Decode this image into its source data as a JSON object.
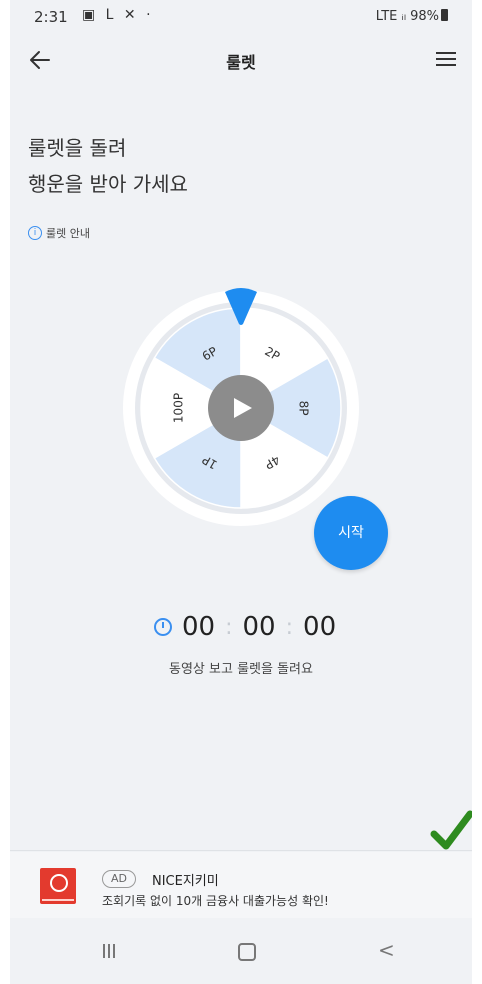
{
  "status_bar": {
    "time": "2:31",
    "icons": "▣ L ✕ ·",
    "right": "LTE ᵢₗ 98%"
  },
  "app_bar": {
    "title": "룰렛",
    "back_icon": "arrow-left-icon",
    "menu_icon": "hamburger-menu-icon"
  },
  "headline": {
    "line1": "룰렛을 돌려",
    "line2": "행운을 받아 가세요"
  },
  "guide": {
    "icon": "i",
    "label": "룰렛 안내"
  },
  "roulette": {
    "segments": [
      {
        "label": "6P",
        "highlight": true
      },
      {
        "label": "2P",
        "highlight": false
      },
      {
        "label": "8P",
        "highlight": true
      },
      {
        "label": "4P",
        "highlight": false
      },
      {
        "label": "1P",
        "highlight": true
      },
      {
        "label": "100P",
        "highlight": false
      }
    ],
    "highlight_color": "#d6e6f9",
    "base_color": "#ffffff",
    "pointer_color": "#1e8cf0",
    "center_icon": "play-icon"
  },
  "start_button": {
    "label": "시작",
    "color": "#1e8cf0"
  },
  "timer": {
    "hours": "00",
    "minutes": "00",
    "seconds": "00",
    "caption": "동영상 보고 룰렛을 돌려요"
  },
  "ad": {
    "badge": "AD",
    "brand": "NICE지키미",
    "text": "조회기록 없이 10개 금융사 대출가능성 확인!"
  },
  "nav_bar": {
    "recent_icon": "recent-apps-icon",
    "home_icon": "home-icon",
    "back_icon": "nav-back-icon",
    "back_glyph": "<"
  }
}
